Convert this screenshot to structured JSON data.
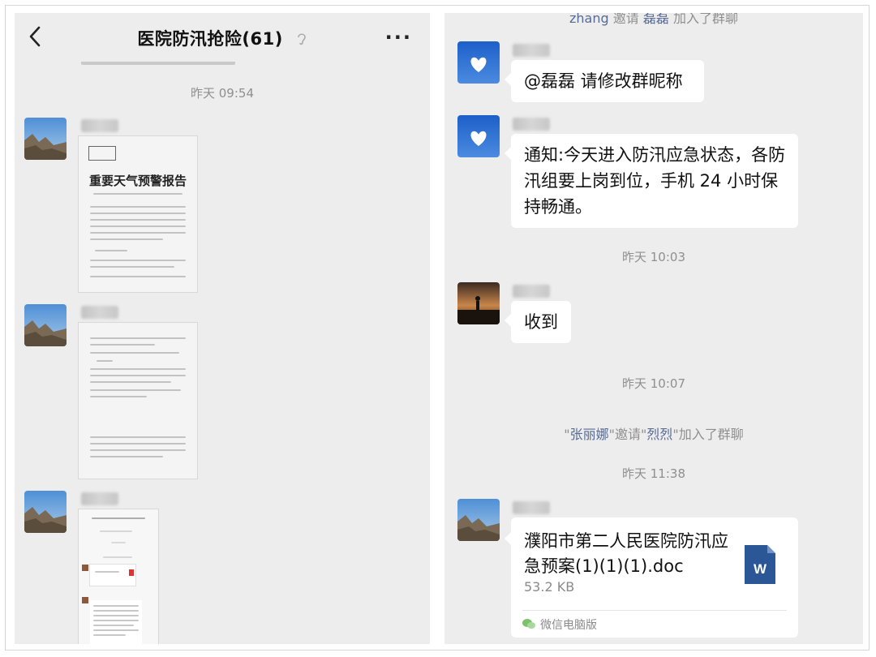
{
  "left": {
    "header": {
      "back_icon": "chevron-left-icon",
      "title": "医院防汛抢险(61)",
      "mute_icon": "ear-icon",
      "more_icon": "more-dots-icon",
      "more_label": "···"
    },
    "timestamp_1": "昨天 09:54",
    "doc1": {
      "stamp": "重要天气预警报告"
    }
  },
  "right": {
    "top_sys": {
      "name_1": "zhang",
      "verb": "邀请",
      "name_2": "磊磊",
      "suffix": "加入了群聊"
    },
    "msg1": "@磊磊  请修改群昵称",
    "msg2": "通知:今天进入防汛应急状态，各防汛组要上岗到位，手机 24 小时保持畅通。",
    "time_1": "昨天 10:03",
    "msg3": "收到",
    "time_2": "昨天 10:07",
    "sys_invite": {
      "q1": "\"",
      "name_1": "张丽娜",
      "mid": "\"邀请\"",
      "name_2": "烈烈",
      "q2": "\"",
      "suffix": "加入了群聊"
    },
    "time_3": "昨天 11:38",
    "file": {
      "name": "濮阳市第二人民医院防汛应急预案(1)(1)(1).doc",
      "size": "53.2 KB",
      "source": "微信电脑版",
      "icon": "word-doc-icon",
      "icon_letter": "W"
    }
  },
  "colors": {
    "bg": "#ededed",
    "bubble": "#ffffff",
    "link": "#576b95",
    "word": "#2b5797"
  }
}
